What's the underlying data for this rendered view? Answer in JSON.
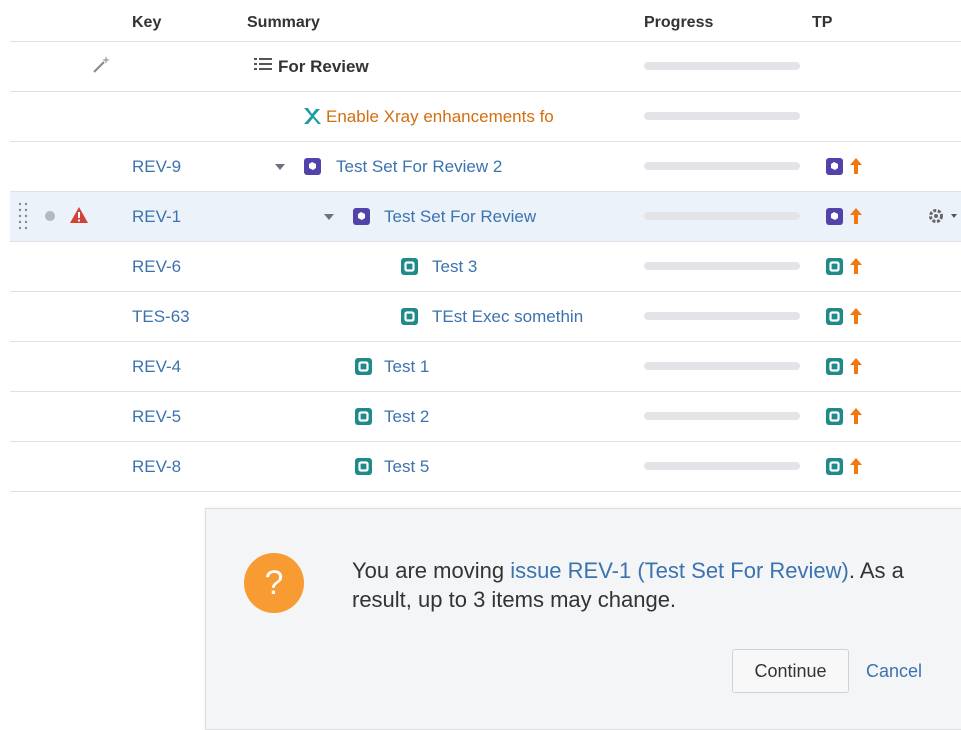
{
  "columns": {
    "key": "Key",
    "summary": "Summary",
    "progress": "Progress",
    "tp": "TP"
  },
  "rows": [
    {
      "key": "",
      "summary": "For Review",
      "type": "group-heading",
      "progress": 0
    },
    {
      "key": "",
      "summary": "Enable Xray enhancements fo",
      "type": "xray",
      "progress": 0
    },
    {
      "key": "REV-9",
      "summary": "Test Set For Review 2",
      "type": "test-set",
      "progress": 0,
      "expanded": true
    },
    {
      "key": "REV-1",
      "summary": "Test Set For Review",
      "type": "test-set",
      "progress": 0,
      "expanded": true,
      "selected": true
    },
    {
      "key": "REV-6",
      "summary": "Test 3",
      "type": "test",
      "progress": 0
    },
    {
      "key": "TES-63",
      "summary": "TEst Exec somethin",
      "type": "test",
      "progress": 0
    },
    {
      "key": "REV-4",
      "summary": "Test 1",
      "type": "test",
      "progress": 0
    },
    {
      "key": "REV-5",
      "summary": "Test 2",
      "type": "test",
      "progress": 0
    },
    {
      "key": "REV-8",
      "summary": "Test 5",
      "type": "test",
      "progress": 0
    }
  ],
  "dialog": {
    "message_prefix": "You are moving ",
    "message_link": "issue REV-1 (Test Set For Review)",
    "message_suffix": ". As a result, up to 3 items may change.",
    "continue_label": "Continue",
    "cancel_label": "Cancel",
    "icon_glyph": "?"
  },
  "icons": {
    "auto": "magic-wand-icon",
    "group": "list-icon",
    "xray": "xray-logo-icon",
    "test_set": "test-set-icon",
    "test": "test-icon",
    "priority": "arrow-up-icon",
    "warning": "warning-icon",
    "gear": "gear-icon",
    "drag": "drag-handle-icon"
  },
  "colors": {
    "link": "#3b73af",
    "selected_row": "#ebf2fa",
    "test_set": "#5243aa",
    "test": "#1f8a8a",
    "priority_arrow": "#f0780e",
    "warning": "#d04437",
    "dialog_icon": "#f89b32",
    "xray_text": "#d36e0f"
  }
}
